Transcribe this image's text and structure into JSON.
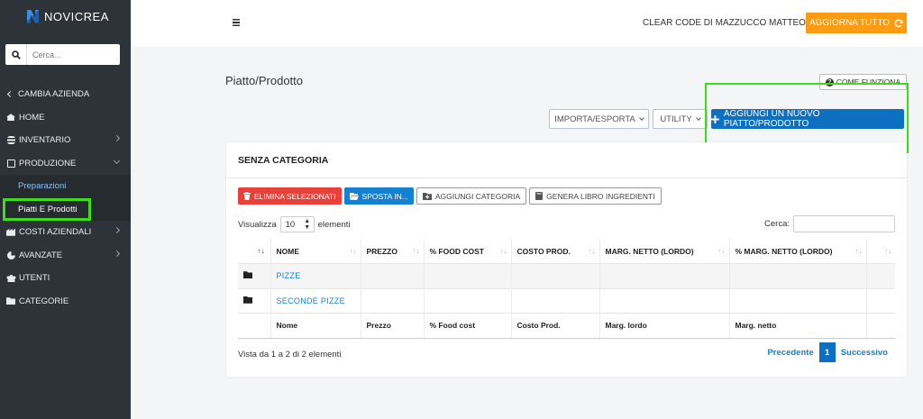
{
  "brand": {
    "name": "NOVICREA"
  },
  "sidebar": {
    "search_placeholder": "Cerca...",
    "items": [
      {
        "label": "CAMBIA AZIENDA",
        "icon": "chevron-left-icon"
      },
      {
        "label": "HOME",
        "icon": "home-icon"
      },
      {
        "label": "INVENTARIO",
        "icon": "database-icon"
      },
      {
        "label": "PRODUZIONE",
        "icon": "box-icon"
      },
      {
        "label": "COSTI AZIENDALI",
        "icon": "industry-icon"
      },
      {
        "label": "AVANZATE",
        "icon": "pie-chart-icon"
      },
      {
        "label": "UTENTI",
        "icon": "users-icon"
      },
      {
        "label": "CATEGORIE",
        "icon": "folder-icon"
      }
    ],
    "sub_items": [
      {
        "label": "Preparazioni"
      },
      {
        "label": "Piatti E Prodotti"
      }
    ]
  },
  "topbar": {
    "company": "CLEAR CODE DI MAZZUCCO MATTEO",
    "update_button": "AGGIORNA TUTTO"
  },
  "page": {
    "title": "Piatto/Prodotto",
    "how_button": "COME FUNZIONA",
    "export_button": "IMPORTA/ESPORTA",
    "utility_button": "UTILITY",
    "add_button": "AGGIUNGI UN NUOVO PIATTO/PRODOTTO"
  },
  "card": {
    "title": "SENZA CATEGORIA",
    "actions": {
      "delete": "ELIMINA SELEZIONATI",
      "move": "SPOSTA IN...",
      "add_category": "AGGIUNGI CATEGORIA",
      "ingredients_book": "GENERA LIBRO INGREDIENTI"
    },
    "show_label": "Visualizza",
    "show_value": "10",
    "show_suffix": "elementi",
    "search_label": "Cerca:",
    "columns": [
      "NOME",
      "PREZZO",
      "% FOOD COST",
      "COSTO PROD.",
      "MARG. NETTO (LORDO)",
      "% MARG. NETTO (LORDO)"
    ],
    "rows": [
      {
        "name": "PIZZE"
      },
      {
        "name": "SECONDE PIZZE"
      }
    ],
    "footer": [
      "Nome",
      "Prezzo",
      "% Food cost",
      "Costo Prod.",
      "Marg. lordo",
      "Marg. netto"
    ],
    "info": "Vista da 1 a 2 di 2 elementi",
    "pager": {
      "prev": "Precedente",
      "current": "1",
      "next": "Successivo"
    }
  },
  "colors": {
    "sidebar_bg": "#2d3338",
    "accent_orange": "#fd9b12",
    "primary_blue": "#0d6fbf",
    "danger_red": "#e8413a",
    "highlight_green": "#3fdc1a"
  }
}
